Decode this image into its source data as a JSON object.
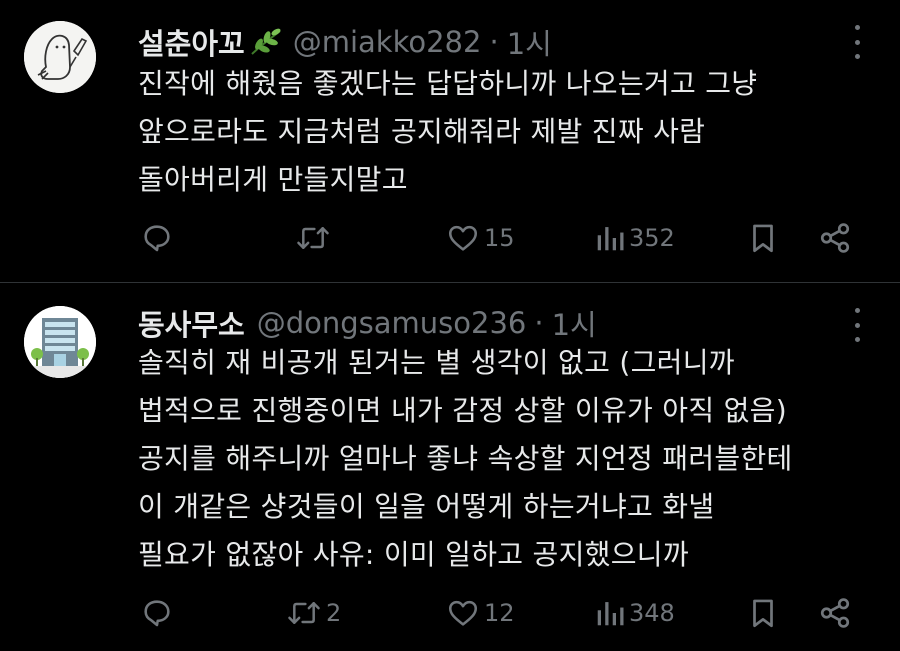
{
  "tweets": [
    {
      "name": "설춘아꼬",
      "handle": "@miakko282",
      "separator": "·",
      "time": "1시",
      "lines": [
        "진작에 해줬음 좋겠다는 답답하니까 나오는거고 그냥",
        "앞으로라도 지금처럼 공지해줘라 제발 진짜 사람",
        "돌아버리게 만들지말고"
      ],
      "replies": "",
      "retweets": "",
      "likes": "15",
      "views": "352"
    },
    {
      "name": "동사무소",
      "handle": "@dongsamuso236",
      "separator": "·",
      "time": "1시",
      "lines": [
        "솔직히 재 비공개 된거는 별 생각이 없고 (그러니까",
        "법적으로 진행중이면 내가 감정 상할 이유가 아직 없음)",
        "공지를 해주니까 얼마나 좋냐 속상할 지언정 패러블한테",
        "이 개같은 샹것들이 일을 어떻게 하는거냐고 화낼",
        "필요가 없잖아 사유: 이미 일하고 공지했으니까"
      ],
      "replies": "",
      "retweets": "2",
      "likes": "12",
      "views": "348"
    }
  ],
  "icons": {
    "reply": "reply-icon",
    "retweet": "retweet-icon",
    "like": "heart-icon",
    "views": "views-icon",
    "bookmark": "bookmark-icon",
    "share": "share-icon",
    "more": "more-icon"
  },
  "colors": {
    "background": "#000000",
    "text": "#e7e9ea",
    "muted": "#71767b",
    "divider": "#2f3336",
    "leaf": "#5a9e3a"
  }
}
